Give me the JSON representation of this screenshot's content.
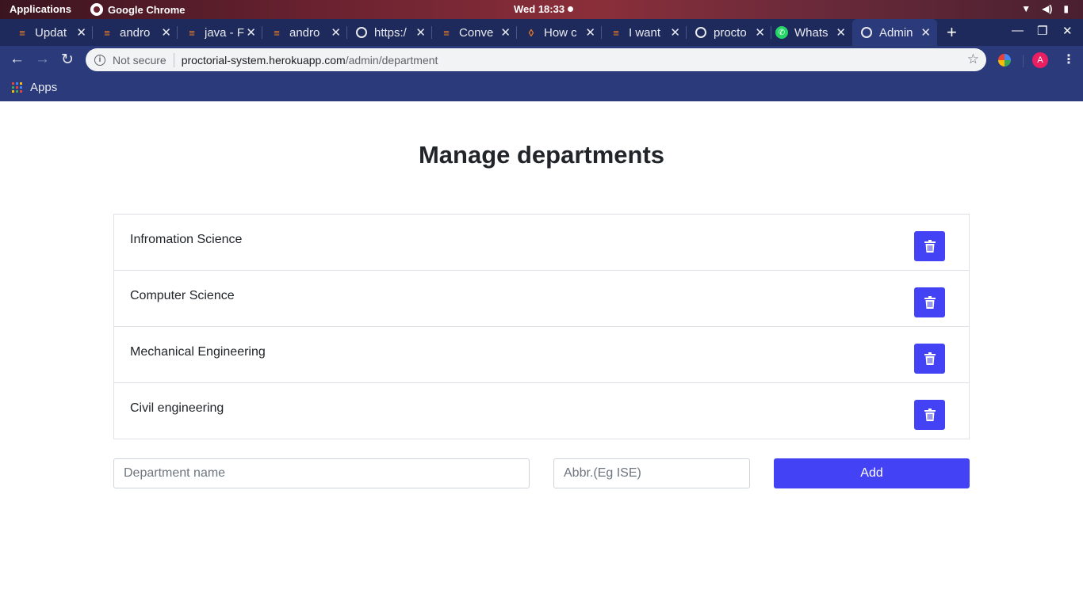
{
  "system_bar": {
    "applications": "Applications",
    "app_name": "Google Chrome",
    "clock": "Wed 18:33"
  },
  "tabs": [
    {
      "title": "Updat",
      "icon": "stackoverflow-icon"
    },
    {
      "title": "andro",
      "icon": "stackoverflow-icon"
    },
    {
      "title": "java - F",
      "icon": "stackoverflow-icon"
    },
    {
      "title": "andro",
      "icon": "stackoverflow-icon"
    },
    {
      "title": "https:/",
      "icon": "globe-icon"
    },
    {
      "title": "Conve",
      "icon": "stackoverflow-icon"
    },
    {
      "title": "How c",
      "icon": "flame-icon"
    },
    {
      "title": "I want",
      "icon": "stackoverflow-icon"
    },
    {
      "title": "procto",
      "icon": "globe-icon"
    },
    {
      "title": "Whats",
      "icon": "whatsapp-icon"
    },
    {
      "title": "Admin",
      "icon": "globe-icon",
      "active": true
    }
  ],
  "address_bar": {
    "security": "Not secure",
    "host": "proctorial-system.herokuapp.com",
    "path": "/admin/department"
  },
  "profile_initial": "A",
  "bookmarks": {
    "apps_label": "Apps"
  },
  "main": {
    "title": "Manage departments",
    "departments": [
      {
        "name": "Infromation Science"
      },
      {
        "name": "Computer Science"
      },
      {
        "name": "Mechanical Engineering"
      },
      {
        "name": "Civil engineering"
      }
    ],
    "form": {
      "name_placeholder": "Department name",
      "abbr_placeholder": "Abbr.(Eg ISE)",
      "add_label": "Add"
    }
  },
  "colors": {
    "accent": "#4343f5",
    "browser_frame": "#2b3a7a",
    "tab_strip": "#1d2a5b"
  }
}
